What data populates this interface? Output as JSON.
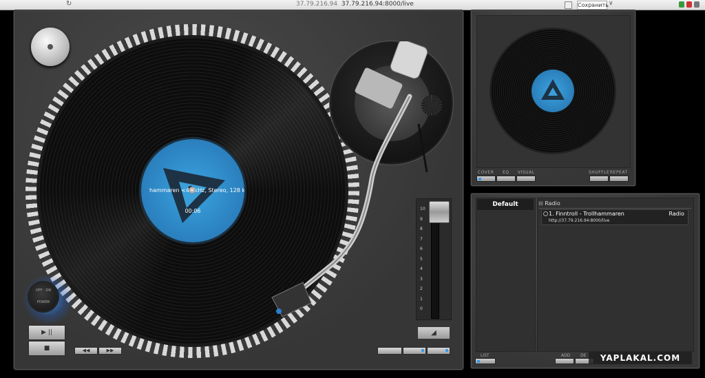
{
  "browser": {
    "url_host": "37.79.216.94",
    "url_full": "37.79.216.94:8000/live",
    "save_label": "Сохранить",
    "reload_icon": "reload-icon"
  },
  "player": {
    "now_playing": "hammaren <44 kHz, Stereo, 128 k",
    "elapsed": "00:06",
    "power_top": "OFF · ON",
    "power_bottom": "POWER",
    "pitch_ticks": [
      "10",
      "9",
      "8",
      "7",
      "6",
      "5",
      "4",
      "3",
      "2",
      "1",
      "0"
    ],
    "play_pause_glyph": "▶ ||",
    "stop_glyph": "■",
    "prev_glyph": "◀◀",
    "next_glyph": "▶▶",
    "pitch_btn_glyph": "◢"
  },
  "mini": {
    "labels": {
      "cover": "COVER",
      "eq": "EQ",
      "visual": "VISUAL",
      "shuffle": "SHUFFLE",
      "repeat": "REPEAT"
    }
  },
  "playlist": {
    "tab": "Default",
    "group": "Radio",
    "item": {
      "title": "1. Finntroll - Trollhammaren",
      "url": "http://37.79.216.94:8000/live",
      "source": "Radio"
    },
    "list_label": "LIST",
    "add_label": "ADD",
    "del_label": "DE"
  },
  "watermark": "YAPLAKAL.COM",
  "colors": {
    "accent_blue": "#3aa4e0",
    "panel": "#3d3d3d",
    "power_glow": "#3ca0ff"
  }
}
